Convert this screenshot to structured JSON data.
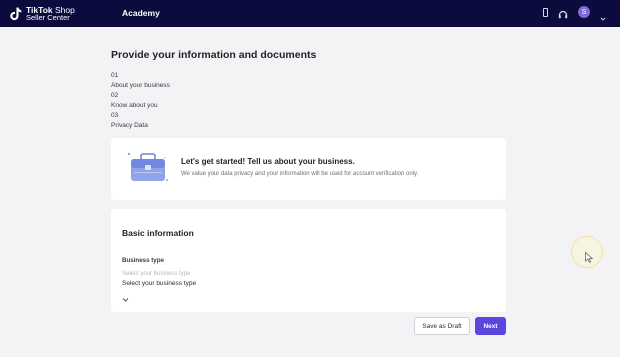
{
  "header": {
    "logo_line1_bold": "TikTok",
    "logo_line1_thin": " Shop",
    "logo_line2": "Seller Center",
    "nav_academy": "Academy",
    "icons": [
      "phone-icon",
      "headset-icon",
      "avatar",
      "chevron-down-icon"
    ],
    "avatar_initial": "S"
  },
  "page": {
    "title": "Provide your information and documents",
    "steps": [
      {
        "number": "01",
        "label": "About your business"
      },
      {
        "number": "02",
        "label": "Know about you"
      },
      {
        "number": "03",
        "label": "Privacy Data"
      }
    ]
  },
  "intro": {
    "title": "Let's get started! Tell us about your business.",
    "description": "We value your data privacy and your information will be used for account verification only."
  },
  "basic_info": {
    "section_title": "Basic information",
    "business_type_label": "Business type",
    "business_type_placeholder": "Select your business type",
    "business_type_value": "Select your business type"
  },
  "actions": {
    "save_draft_label": "Save as Draft",
    "next_label": "Next"
  },
  "colors": {
    "header_bg": "#0b0b3e",
    "accent": "#5b46e0",
    "page_bg": "#f3f3f5"
  }
}
